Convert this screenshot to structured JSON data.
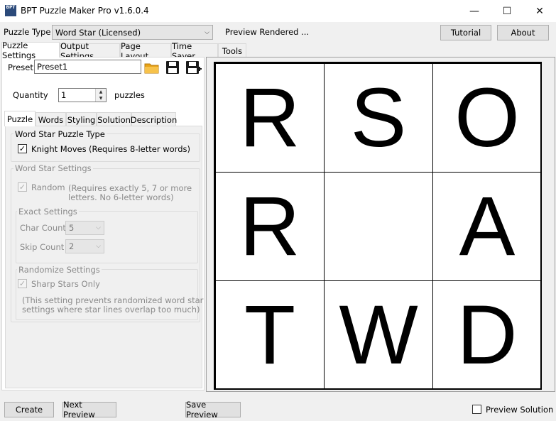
{
  "window": {
    "title": "BPT Puzzle Maker Pro v1.6.0.4",
    "icon_text": "BPT",
    "minimize_glyph": "—",
    "maximize_glyph": "☐",
    "close_glyph": "✕"
  },
  "toolbar": {
    "puzzle_type_label": "Puzzle Type",
    "puzzle_type_value": "Word Star (Licensed)",
    "preview_status": "Preview Rendered ...",
    "tutorial_label": "Tutorial",
    "about_label": "About"
  },
  "main_tabs": [
    "Puzzle Settings",
    "Output Settings",
    "Page Layout",
    "Time Saver",
    "Tools"
  ],
  "preset": {
    "label": "Preset",
    "value": "Preset1"
  },
  "quantity": {
    "label": "Quantity",
    "value": "1",
    "unit": "puzzles"
  },
  "sub_tabs": [
    "Puzzle",
    "Words",
    "Styling",
    "Solution",
    "Description"
  ],
  "word_star_type": {
    "group_label": "Word Star Puzzle Type",
    "knight_moves_label": "Knight Moves",
    "knight_moves_checked": true,
    "knight_moves_note": "(Requires 8-letter words)"
  },
  "word_star_settings": {
    "group_label": "Word Star Settings",
    "random_label": "Random",
    "random_checked": true,
    "random_note_line1": "(Requires exactly 5, 7 or more",
    "random_note_line2": "letters. No 6-letter words)",
    "exact_settings_label": "Exact Settings",
    "char_count_label": "Char Count",
    "char_count_value": "5",
    "skip_count_label": "Skip Count",
    "skip_count_value": "2",
    "randomize_settings_label": "Randomize Settings",
    "sharp_stars_label": "Sharp Stars Only",
    "sharp_stars_checked": true,
    "sharp_stars_note_line1": "(This setting prevents randomized word star",
    "sharp_stars_note_line2": "settings where star lines overlap too much)"
  },
  "preview_grid": [
    [
      "R",
      "S",
      "O"
    ],
    [
      "R",
      "",
      "A"
    ],
    [
      "T",
      "W",
      "D"
    ]
  ],
  "bottom": {
    "create_label": "Create",
    "next_preview_label": "Next Preview",
    "save_preview_label": "Save Preview",
    "preview_solution_label": "Preview Solution",
    "preview_solution_checked": false
  },
  "colors": {
    "folder_icon": "#e8a317",
    "save_icon": "#1a1a1a"
  }
}
